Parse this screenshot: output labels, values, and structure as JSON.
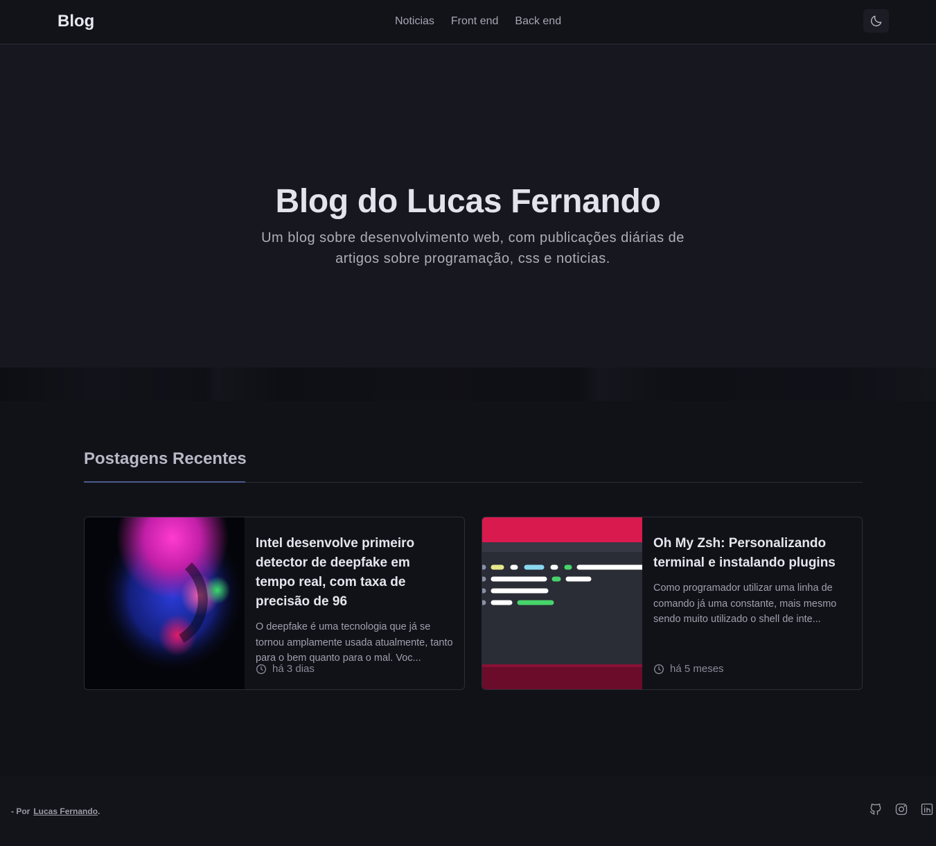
{
  "header": {
    "logo": "Blog",
    "nav": [
      "Noticias",
      "Front end",
      "Back end"
    ],
    "theme_toggle_icon": "moon-icon"
  },
  "hero": {
    "title": "Blog do Lucas Fernando",
    "subtitle": "Um blog sobre desenvolvimento web, com publicações diárias de artigos sobre programação, css e noticias."
  },
  "recent": {
    "title": "Postagens Recentes",
    "posts": [
      {
        "title": "Intel desenvolve primeiro detector de deepfake em tempo real, com taxa de precisão de 96",
        "excerpt": "O deepfake é uma tecnologia que já se tornou amplamente usada atualmente, tanto para o bem quanto para o mal. Voc...",
        "date": "há 3 dias",
        "image": "neon-face-image"
      },
      {
        "title": "Oh My Zsh: Personalizando terminal e instalando plugins",
        "excerpt": "Como programador utilizar uma linha de comando já uma constante, mais mesmo sendo muito utilizado o shell de inte...",
        "date": "há 5 meses",
        "image": "terminal-code-image"
      }
    ]
  },
  "footer": {
    "prefix": "- Por",
    "author": "Lucas Fernando",
    "suffix": ".",
    "social": [
      "github-icon",
      "instagram-icon",
      "linkedin-icon"
    ]
  },
  "colors": {
    "background": "#111218",
    "hero_background": "#17181f",
    "accent_line": "#4c5a8e",
    "text_primary": "#e3e3ee",
    "text_muted": "#9fa0ad"
  }
}
